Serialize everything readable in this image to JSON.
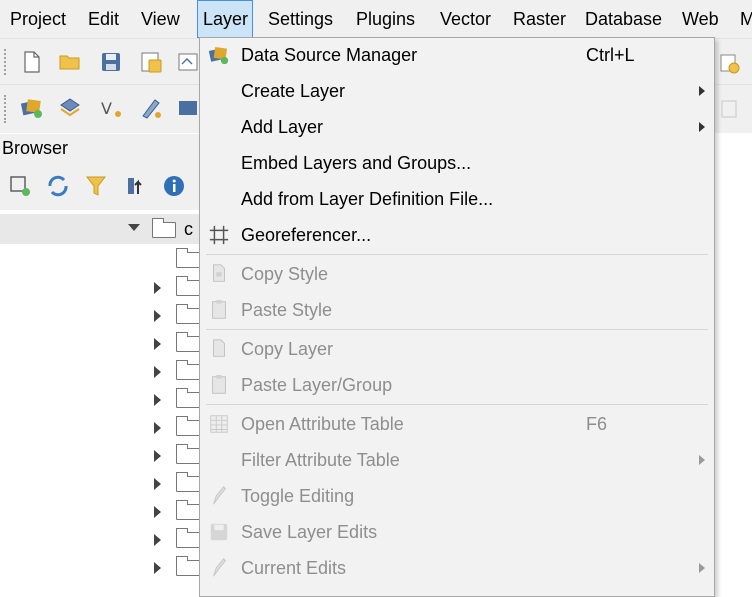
{
  "menubar": {
    "items": [
      {
        "label": "Project"
      },
      {
        "label": "Edit"
      },
      {
        "label": "View"
      },
      {
        "label": "Layer"
      },
      {
        "label": "Settings"
      },
      {
        "label": "Plugins"
      },
      {
        "label": "Vector"
      },
      {
        "label": "Raster"
      },
      {
        "label": "Database"
      },
      {
        "label": "Web"
      },
      {
        "label": "M"
      }
    ],
    "active": "Layer"
  },
  "browser": {
    "title": "Browser",
    "root_label": "c"
  },
  "layer_menu": {
    "items": [
      {
        "label": "Data Source Manager",
        "shortcut": "Ctrl+L",
        "enabled": true,
        "submenu": false,
        "icon": "data-source-manager-icon"
      },
      {
        "label": "Create Layer",
        "enabled": true,
        "submenu": true
      },
      {
        "label": "Add Layer",
        "enabled": true,
        "submenu": true
      },
      {
        "label": "Embed Layers and Groups...",
        "enabled": true,
        "submenu": false
      },
      {
        "label": "Add from Layer Definition File...",
        "enabled": true,
        "submenu": false
      },
      {
        "label": "Georeferencer...",
        "enabled": true,
        "submenu": false,
        "icon": "georeferencer-icon"
      },
      {
        "label": "Copy Style",
        "enabled": false,
        "submenu": false,
        "icon": "copy-style-icon"
      },
      {
        "label": "Paste Style",
        "enabled": false,
        "submenu": false,
        "icon": "paste-style-icon"
      },
      {
        "label": "Copy Layer",
        "enabled": false,
        "submenu": false,
        "icon": "copy-layer-icon"
      },
      {
        "label": "Paste Layer/Group",
        "enabled": false,
        "submenu": false,
        "icon": "paste-layer-icon"
      },
      {
        "label": "Open Attribute Table",
        "shortcut": "F6",
        "enabled": false,
        "submenu": false,
        "icon": "attribute-table-icon"
      },
      {
        "label": "Filter Attribute Table",
        "enabled": false,
        "submenu": true
      },
      {
        "label": "Toggle Editing",
        "enabled": false,
        "submenu": false,
        "icon": "pencil-icon"
      },
      {
        "label": "Save Layer Edits",
        "enabled": false,
        "submenu": false,
        "icon": "save-edits-icon"
      },
      {
        "label": "Current Edits",
        "enabled": false,
        "submenu": true,
        "icon": "current-edits-icon"
      }
    ]
  },
  "colors": {
    "menubar_bg": "#f0f0f0",
    "menu_bg": "#f2f2f2",
    "active_border": "#4a90d9",
    "active_bg": "#cce4f7",
    "disabled_text": "#8e8e8e"
  }
}
